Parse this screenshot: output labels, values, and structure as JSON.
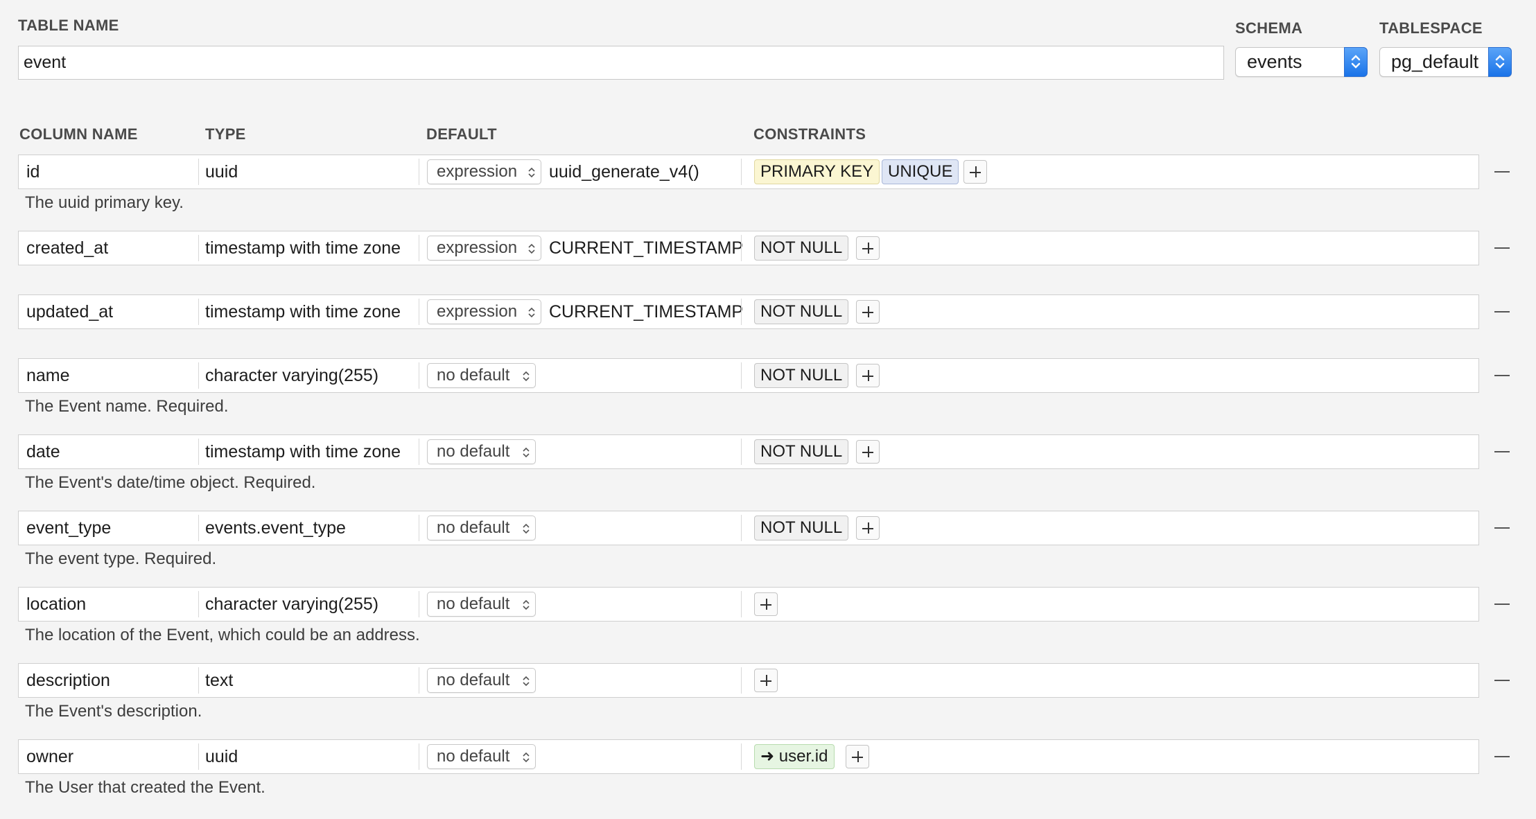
{
  "header": {
    "table_name_label": "TABLE NAME",
    "table_name_value": "event",
    "schema_label": "SCHEMA",
    "schema_value": "events",
    "tablespace_label": "TABLESPACE",
    "tablespace_value": "pg_default"
  },
  "columns_header": {
    "name": "COLUMN NAME",
    "type": "TYPE",
    "default": "DEFAULT",
    "constraints": "CONSTRAINTS"
  },
  "rows": [
    {
      "name": "id",
      "type": "uuid",
      "default_mode": "expression",
      "default_value": "uuid_generate_v4()",
      "constraints": [
        {
          "label": "PRIMARY KEY",
          "kind": "pk"
        },
        {
          "label": "UNIQUE",
          "kind": "unique"
        }
      ],
      "description": "The uuid primary key."
    },
    {
      "name": "created_at",
      "type": "timestamp with time zone",
      "default_mode": "expression",
      "default_value": "CURRENT_TIMESTAMP",
      "constraints": [
        {
          "label": "NOT NULL",
          "kind": "notnull"
        }
      ],
      "description": ""
    },
    {
      "name": "updated_at",
      "type": "timestamp with time zone",
      "default_mode": "expression",
      "default_value": "CURRENT_TIMESTAMP",
      "constraints": [
        {
          "label": "NOT NULL",
          "kind": "notnull"
        }
      ],
      "description": ""
    },
    {
      "name": "name",
      "type": "character varying(255)",
      "default_mode": "no default",
      "default_value": "",
      "constraints": [
        {
          "label": "NOT NULL",
          "kind": "notnull"
        }
      ],
      "description": "The Event name. Required."
    },
    {
      "name": "date",
      "type": "timestamp with time zone",
      "default_mode": "no default",
      "default_value": "",
      "constraints": [
        {
          "label": "NOT NULL",
          "kind": "notnull"
        }
      ],
      "description": "The Event's date/time object. Required."
    },
    {
      "name": "event_type",
      "type": "events.event_type",
      "default_mode": "no default",
      "default_value": "",
      "constraints": [
        {
          "label": "NOT NULL",
          "kind": "notnull"
        }
      ],
      "description": "The event type. Required."
    },
    {
      "name": "location",
      "type": "character varying(255)",
      "default_mode": "no default",
      "default_value": "",
      "constraints": [],
      "description": "The location of the Event, which could be an address."
    },
    {
      "name": "description",
      "type": "text",
      "default_mode": "no default",
      "default_value": "",
      "constraints": [],
      "description": "The Event's description."
    },
    {
      "name": "owner",
      "type": "uuid",
      "default_mode": "no default",
      "default_value": "",
      "constraints": [
        {
          "label": "➜ user.id",
          "kind": "fk"
        }
      ],
      "description": "The User that created the Event."
    }
  ],
  "icons": {
    "stepper": "up-down-chevron-icon",
    "add": "plus-icon",
    "remove": "minus-icon"
  },
  "colors": {
    "accent": "#1a73e8",
    "pk": "#fbf6d2",
    "unique": "#dfe6f5",
    "fk": "#e6f5e2"
  }
}
